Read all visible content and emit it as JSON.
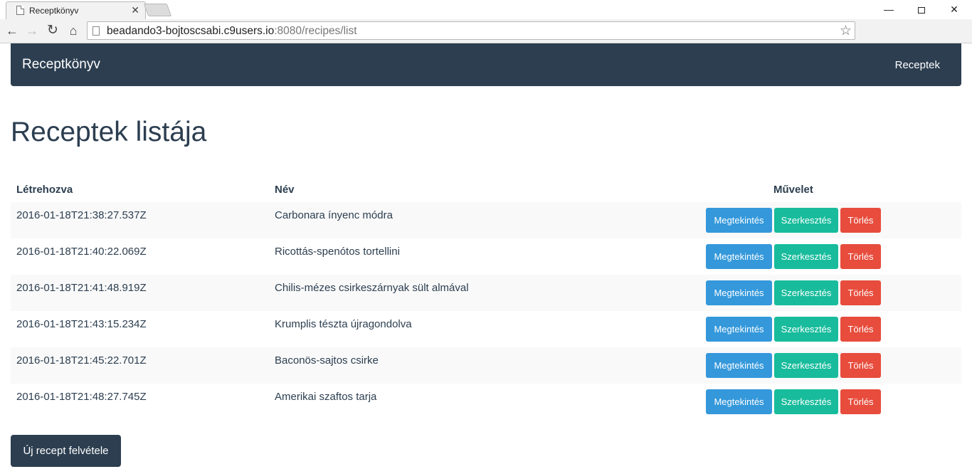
{
  "browser": {
    "tab_title": "Receptkönyv",
    "url_host": "beadando3-bojtoscsabi.c9users.io",
    "url_rest": ":8080/recipes/list"
  },
  "navbar": {
    "brand": "Receptkönyv",
    "link": "Receptek"
  },
  "page": {
    "title": "Receptek listája"
  },
  "table": {
    "headers": {
      "created": "Létrehozva",
      "name": "Név",
      "action": "Művelet"
    },
    "rows": [
      {
        "created": "2016-01-18T21:38:27.537Z",
        "name": "Carbonara ínyenc módra"
      },
      {
        "created": "2016-01-18T21:40:22.069Z",
        "name": "Ricottás-spenótos tortellini"
      },
      {
        "created": "2016-01-18T21:41:48.919Z",
        "name": "Chilis-mézes csirkeszárnyak sült almával"
      },
      {
        "created": "2016-01-18T21:43:15.234Z",
        "name": "Krumplis tészta újragondolva"
      },
      {
        "created": "2016-01-18T21:45:22.701Z",
        "name": "Baconös-sajtos csirke"
      },
      {
        "created": "2016-01-18T21:48:27.745Z",
        "name": "Amerikai szaftos tarja"
      }
    ],
    "buttons": {
      "view": "Megtekintés",
      "edit": "Szerkesztés",
      "delete": "Törlés"
    }
  },
  "new_recipe_button": "Új recept felvétele",
  "colors": {
    "navbar": "#2c3e50",
    "view": "#3498db",
    "edit": "#18bc9c",
    "delete": "#e74c3c"
  }
}
